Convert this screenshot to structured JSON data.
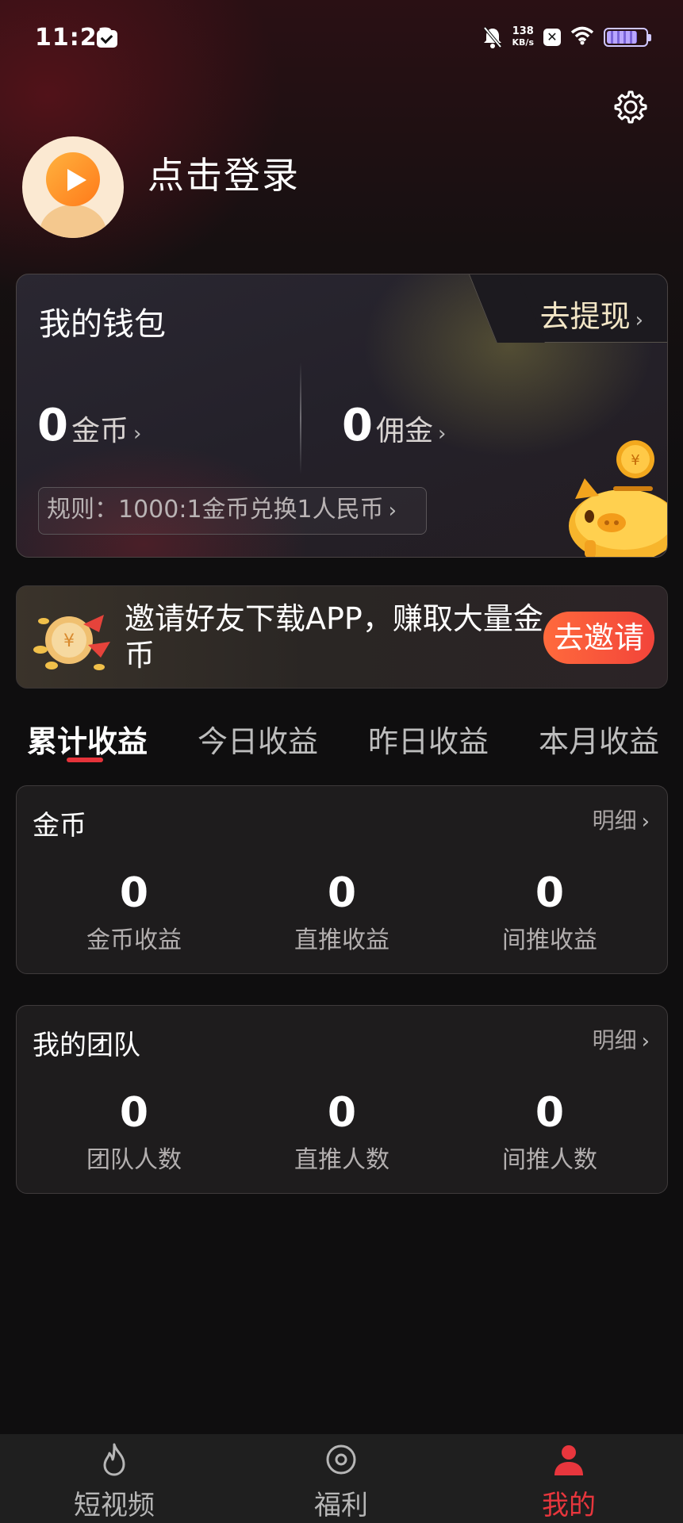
{
  "status_bar": {
    "time": "11:23",
    "speed_value": "138",
    "speed_unit": "KB/s"
  },
  "header": {
    "login_text": "点击登录"
  },
  "wallet": {
    "title": "我的钱包",
    "withdraw_label": "去提现",
    "coins_value": "0",
    "coins_label": "金币",
    "commission_value": "0",
    "commission_label": "佣金",
    "rule_text": "规则：1000:1金币兑换1人民币"
  },
  "invite": {
    "text": "邀请好友下载APP，赚取大量金币",
    "button_label": "去邀请"
  },
  "tabs": [
    {
      "label": "累计收益"
    },
    {
      "label": "今日收益"
    },
    {
      "label": "昨日收益"
    },
    {
      "label": "本月收益"
    }
  ],
  "coin_card": {
    "title": "金币",
    "detail_label": "明细",
    "stats": [
      {
        "value": "0",
        "label": "金币收益"
      },
      {
        "value": "0",
        "label": "直推收益"
      },
      {
        "value": "0",
        "label": "间推收益"
      }
    ]
  },
  "team_card": {
    "title": "我的团队",
    "detail_label": "明细",
    "stats": [
      {
        "value": "0",
        "label": "团队人数"
      },
      {
        "value": "0",
        "label": "直推人数"
      },
      {
        "value": "0",
        "label": "间推人数"
      }
    ]
  },
  "bottom_nav": [
    {
      "label": "短视频",
      "icon": "flame-icon"
    },
    {
      "label": "福利",
      "icon": "target-icon"
    },
    {
      "label": "我的",
      "icon": "person-icon"
    }
  ],
  "colors": {
    "accent_red": "#e8363d",
    "invite_button": "#f2443a",
    "background": "#0f0e0f"
  }
}
